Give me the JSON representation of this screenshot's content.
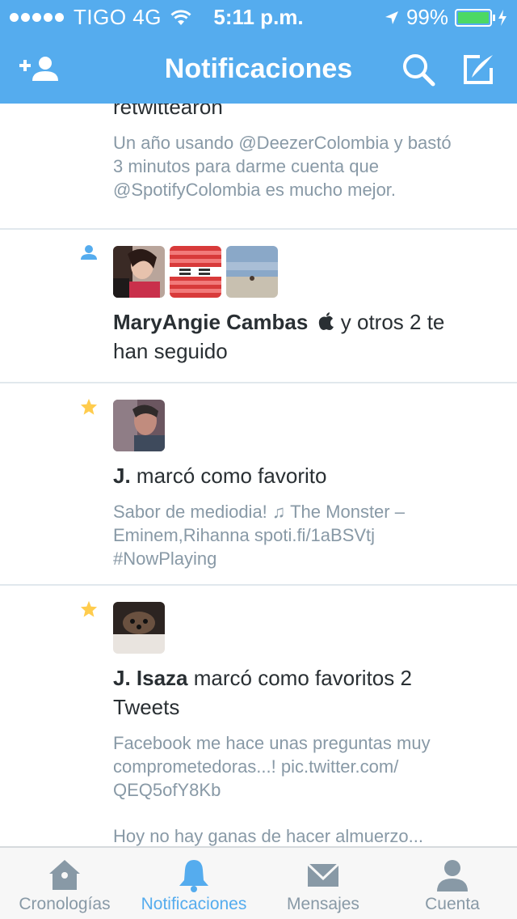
{
  "status_bar": {
    "carrier": "TIGO 4G",
    "time": "5:11 p.m.",
    "battery": "99%",
    "battery_level": 0.99
  },
  "nav": {
    "title": "Notificaciones"
  },
  "colors": {
    "brand": "#55acee",
    "text": "#292f33",
    "secondary": "#8899a6",
    "star": "#ffcc4d",
    "battery": "#4cd964"
  },
  "feed": {
    "item0": {
      "action": "retwittearon",
      "tweet": [
        "Un año usando @DeezerColombia y bastó",
        "3 minutos para darme cuenta que",
        "@SpotifyColombia es mucho mejor."
      ]
    },
    "item1": {
      "icon": "person-icon",
      "name": "MaryAngie Cambas",
      "action_1": " y otros 2 te",
      "action_2": "han seguido"
    },
    "item2": {
      "icon": "star-icon",
      "name": "J.",
      "action": " marcó como favorito",
      "tweet": [
        "Sabor de mediodia! ♫ The Monster –",
        "Eminem,Rihanna spoti.fi/1aBSVtj",
        "#NowPlaying"
      ]
    },
    "item3": {
      "icon": "star-icon",
      "name": "J. Isaza",
      "action_1": " marcó como favoritos 2",
      "action_2": "Tweets",
      "tweet": [
        "Facebook me hace unas preguntas muy",
        "comprometedoras...! pic.twitter.com/",
        "QEQ5ofY8Kb"
      ],
      "tweet2": "Hoy no hay ganas de hacer almuerzo..."
    }
  },
  "tabs": [
    {
      "label": "Cronologías",
      "icon": "home-icon",
      "active": false
    },
    {
      "label": "Notificaciones",
      "icon": "bell-icon",
      "active": true
    },
    {
      "label": "Mensajes",
      "icon": "envelope-icon",
      "active": false
    },
    {
      "label": "Cuenta",
      "icon": "person-icon",
      "active": false
    }
  ]
}
